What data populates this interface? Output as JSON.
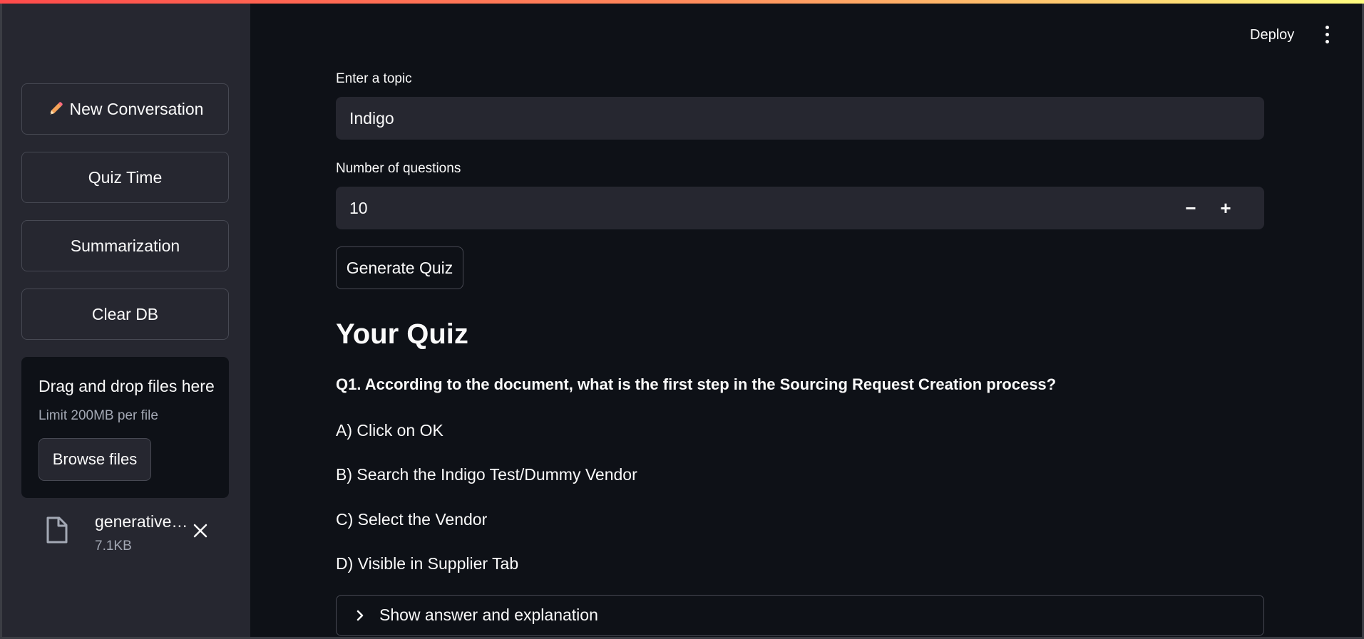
{
  "sidebar": {
    "buttons": [
      {
        "label": "New Conversation",
        "icon": "pencil-icon"
      },
      {
        "label": "Quiz Time"
      },
      {
        "label": "Summarization"
      },
      {
        "label": "Clear DB"
      }
    ],
    "uploader": {
      "title": "Drag and drop files here",
      "limit": "Limit 200MB per file",
      "browse_label": "Browse files"
    },
    "file": {
      "name": "generative…",
      "size": "7.1KB",
      "icon": "file-icon"
    }
  },
  "header": {
    "deploy_label": "Deploy",
    "menu_icon": "kebab-menu-icon"
  },
  "main": {
    "topic_label": "Enter a topic",
    "topic_value": "Indigo",
    "count_label": "Number of questions",
    "count_value": "10",
    "decrement": "−",
    "increment": "+",
    "generate_label": "Generate Quiz",
    "quiz_title": "Your Quiz",
    "question": "Q1. According to the document, what is the first step in the Sourcing Request Creation process?",
    "options": [
      "A) Click on OK",
      "B) Search the Indigo Test/Dummy Vendor",
      "C) Select the Vendor",
      "D) Visible in Supplier Tab"
    ],
    "expander_label": "Show answer and explanation"
  },
  "colors": {
    "background": "#0e1117",
    "sidebar": "#262730",
    "input": "#262730",
    "border": "#474953",
    "text": "#fafafa",
    "muted": "#a3a8b4",
    "accent_start": "#ff4b4b",
    "accent_end": "#fffd80"
  }
}
